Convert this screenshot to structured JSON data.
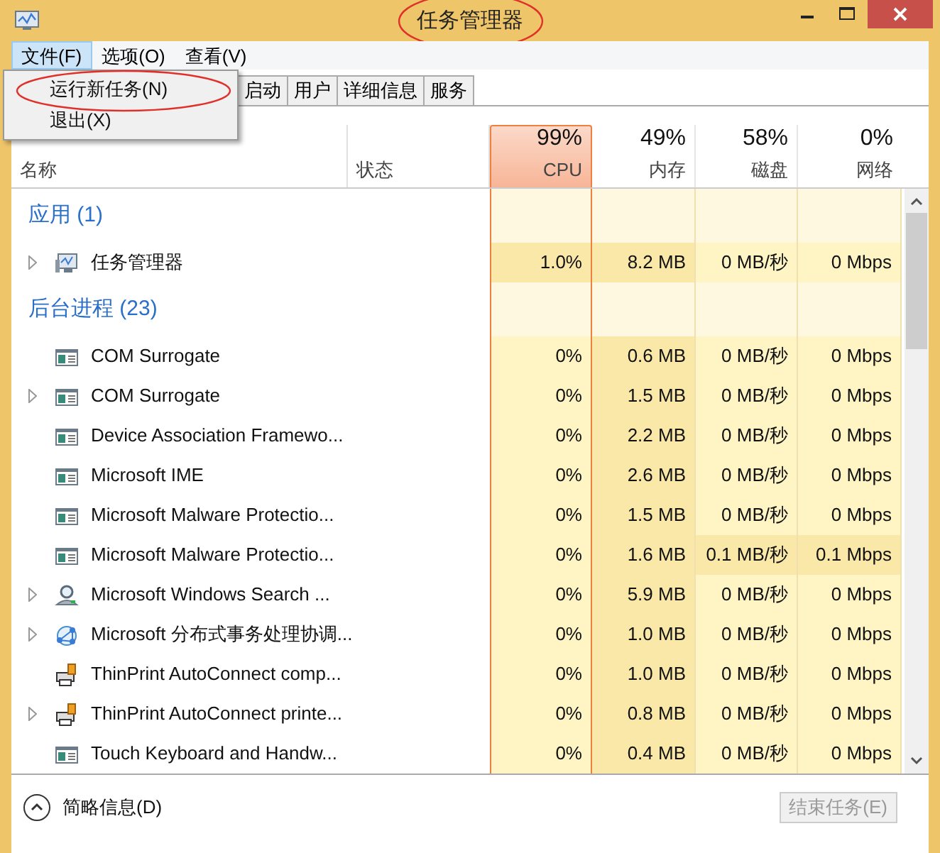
{
  "window": {
    "title": "任务管理器",
    "title_circled": true
  },
  "menu": [
    {
      "label": "文件(F)",
      "selected": true
    },
    {
      "label": "选项(O)",
      "selected": false
    },
    {
      "label": "查看(V)",
      "selected": false
    }
  ],
  "dropdown": [
    {
      "label": "运行新任务(N)",
      "circled": true
    },
    {
      "label": "退出(X)",
      "circled": false
    }
  ],
  "tabs": [
    {
      "label": "启动",
      "selected": false
    },
    {
      "label": "用户",
      "selected": false
    },
    {
      "label": "详细信息",
      "selected": false
    },
    {
      "label": "服务",
      "selected": false
    }
  ],
  "columns": [
    {
      "label": "名称"
    },
    {
      "label": "状态"
    },
    {
      "label": "CPU",
      "percent": "99%",
      "hot": true
    },
    {
      "label": "内存",
      "percent": "49%",
      "hot": false
    },
    {
      "label": "磁盘",
      "percent": "58%",
      "hot": false
    },
    {
      "label": "网络",
      "percent": "0%",
      "hot": false
    }
  ],
  "groups": [
    {
      "title": "应用 (1)",
      "rows": [
        {
          "name": "任务管理器",
          "kind": "app",
          "expandable": true,
          "cells": [
            {
              "text": "1.0%",
              "active": true
            },
            {
              "text": "8.2 MB"
            },
            {
              "text": "0 MB/秒",
              "active": false
            },
            {
              "text": "0 Mbps",
              "active": false
            }
          ]
        }
      ]
    },
    {
      "title": "后台进程 (23)",
      "rows": [
        {
          "name": "COM Surrogate",
          "kind": "process",
          "expandable": false,
          "cells": [
            {
              "text": "0%",
              "active": false
            },
            {
              "text": "0.6 MB"
            },
            {
              "text": "0 MB/秒",
              "active": false
            },
            {
              "text": "0 Mbps",
              "active": false
            }
          ]
        },
        {
          "name": "COM Surrogate",
          "kind": "process",
          "expandable": true,
          "cells": [
            {
              "text": "0%",
              "active": false
            },
            {
              "text": "1.5 MB"
            },
            {
              "text": "0 MB/秒",
              "active": false
            },
            {
              "text": "0 Mbps",
              "active": false
            }
          ]
        },
        {
          "name": "Device Association Framewo...",
          "kind": "process",
          "expandable": false,
          "cells": [
            {
              "text": "0%",
              "active": false
            },
            {
              "text": "2.2 MB"
            },
            {
              "text": "0 MB/秒",
              "active": false
            },
            {
              "text": "0 Mbps",
              "active": false
            }
          ]
        },
        {
          "name": "Microsoft IME",
          "kind": "process",
          "expandable": false,
          "cells": [
            {
              "text": "0%",
              "active": false
            },
            {
              "text": "2.6 MB"
            },
            {
              "text": "0 MB/秒",
              "active": false
            },
            {
              "text": "0 Mbps",
              "active": false
            }
          ]
        },
        {
          "name": "Microsoft Malware Protectio...",
          "kind": "process",
          "expandable": false,
          "cells": [
            {
              "text": "0%",
              "active": false
            },
            {
              "text": "1.5 MB"
            },
            {
              "text": "0 MB/秒",
              "active": false
            },
            {
              "text": "0 Mbps",
              "active": false
            }
          ]
        },
        {
          "name": "Microsoft Malware Protectio...",
          "kind": "process",
          "expandable": false,
          "cells": [
            {
              "text": "0%",
              "active": false
            },
            {
              "text": "1.6 MB"
            },
            {
              "text": "0.1 MB/秒",
              "active": true
            },
            {
              "text": "0.1 Mbps",
              "active": true
            }
          ]
        },
        {
          "name": "Microsoft Windows Search ...",
          "kind": "search",
          "expandable": true,
          "cells": [
            {
              "text": "0%",
              "active": false
            },
            {
              "text": "5.9 MB"
            },
            {
              "text": "0 MB/秒",
              "active": false
            },
            {
              "text": "0 Mbps",
              "active": false
            }
          ]
        },
        {
          "name": "Microsoft 分布式事务处理协调...",
          "kind": "network",
          "expandable": true,
          "cells": [
            {
              "text": "0%",
              "active": false
            },
            {
              "text": "1.0 MB"
            },
            {
              "text": "0 MB/秒",
              "active": false
            },
            {
              "text": "0 Mbps",
              "active": false
            }
          ]
        },
        {
          "name": "ThinPrint AutoConnect comp...",
          "kind": "printer",
          "expandable": false,
          "cells": [
            {
              "text": "0%",
              "active": false
            },
            {
              "text": "1.0 MB"
            },
            {
              "text": "0 MB/秒",
              "active": false
            },
            {
              "text": "0 Mbps",
              "active": false
            }
          ]
        },
        {
          "name": "ThinPrint AutoConnect printe...",
          "kind": "printer",
          "expandable": true,
          "cells": [
            {
              "text": "0%",
              "active": false
            },
            {
              "text": "0.8 MB"
            },
            {
              "text": "0 MB/秒",
              "active": false
            },
            {
              "text": "0 Mbps",
              "active": false
            }
          ]
        },
        {
          "name": "Touch Keyboard and Handw...",
          "kind": "process",
          "expandable": false,
          "cells": [
            {
              "text": "0%",
              "active": false
            },
            {
              "text": "0.4 MB"
            },
            {
              "text": "0 MB/秒",
              "active": false
            },
            {
              "text": "0 Mbps",
              "active": false
            }
          ]
        }
      ]
    }
  ],
  "footer": {
    "details_label": "简略信息(D)",
    "end_task": {
      "label": "结束任务(E)",
      "disabled": true
    }
  }
}
